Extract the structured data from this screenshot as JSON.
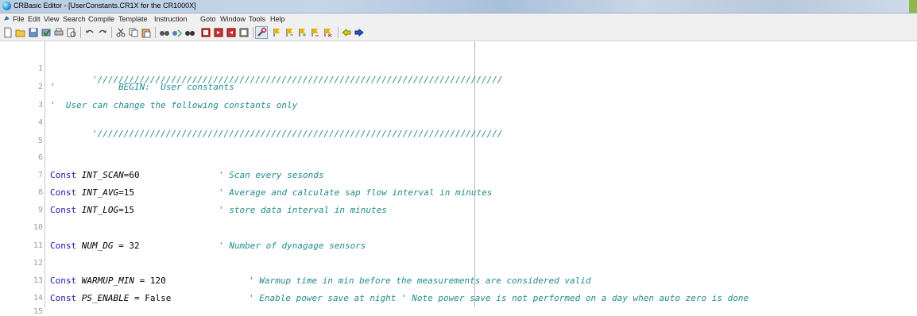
{
  "window": {
    "title": "CRBasic Editor - [UserConstants.CR1X for the CR1000X]",
    "accent_green": "#8db84a"
  },
  "menu": {
    "items": [
      "File",
      "Edit",
      "View",
      "Search",
      "Compile",
      "Template",
      "Instruction",
      "Goto",
      "Window",
      "Tools",
      "Help"
    ]
  },
  "toolbar": {
    "buttons": [
      "new-file-icon",
      "open-file-icon",
      "save-icon",
      "compile-icon",
      "print-icon",
      "print-preview-icon",
      "undo-icon",
      "redo-icon",
      "cut-icon",
      "copy-icon",
      "paste-icon",
      "find-icon",
      "replace-icon",
      "find-next-icon",
      "bookmark-icon",
      "bookmark-next-icon",
      "bookmark-prev-icon",
      "bookmark-clear-icon",
      "wrench-icon",
      "instruction-flag-1-icon",
      "instruction-flag-2-icon",
      "instruction-flag-3-icon",
      "instruction-flag-4-icon",
      "instruction-flag-5-icon",
      "navigate-back-icon",
      "navigate-forward-icon"
    ]
  },
  "editor": {
    "line_numbers": [
      "1",
      "2",
      "3",
      "4",
      "5",
      "6",
      "7",
      "8",
      "9",
      "10",
      "11",
      "12",
      "13",
      "14",
      "15"
    ],
    "lines": {
      "l1": "'/////////////////////////////////////////////////////////////////////////////",
      "l2_q": "'",
      "l2_c": "            BEGIN:  User constants",
      "l3_q": "'",
      "l3_c": "  User can change the following constants only",
      "l4": "'/////////////////////////////////////////////////////////////////////////////",
      "l7_kw": "Const",
      "l7_id": "INT_SCAN",
      "l7_val": "=60",
      "l7_cm": "' Scan every sesonds",
      "l8_kw": "Const",
      "l8_id": "INT_AVG",
      "l8_val": "=15",
      "l8_cm": "' Average and calculate sap flow interval in minutes",
      "l9_kw": "Const",
      "l9_id": "INT_LOG",
      "l9_val": "=15",
      "l9_cm": "' store data interval in minutes",
      "l11_kw": "Const",
      "l11_id": "NUM_DG",
      "l11_val": " = 32",
      "l11_cm": "' Number of dynagage sensors",
      "l13_kw": "Const",
      "l13_id": "WARMUP_MIN",
      "l13_val": " = 120",
      "l13_cm": "' Warmup time in min before the measurements are considered valid",
      "l15_kw": "Const",
      "l15_id": "PS_ENABLE",
      "l15_val": " = False",
      "l15_cm": "' Enable power save at night ' Note power save is not performed on a day when auto zero is done"
    }
  }
}
